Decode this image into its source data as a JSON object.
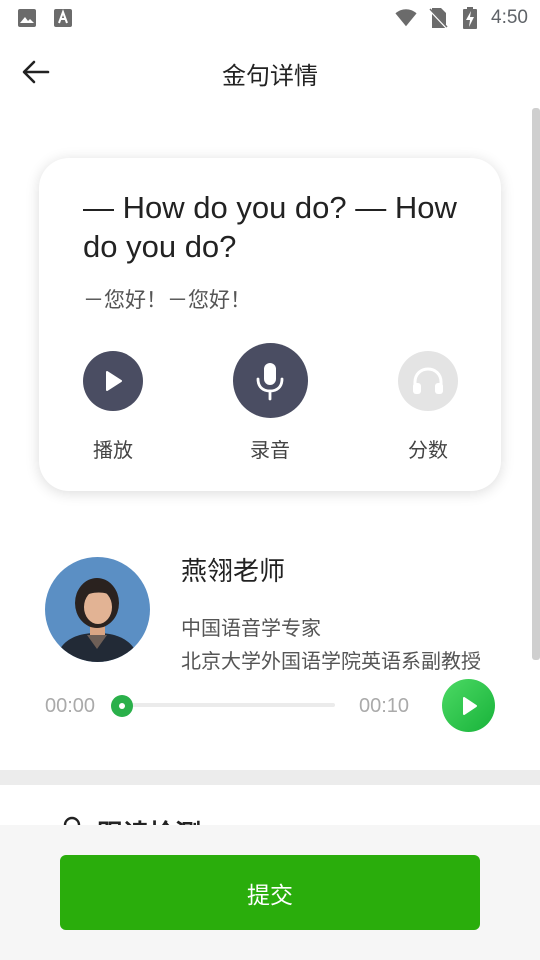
{
  "status_bar": {
    "time": "4:50",
    "left_icons": [
      "image-icon",
      "text-a-icon"
    ],
    "right_icons": [
      "wifi-icon",
      "no-sim-icon",
      "battery-charging-icon"
    ]
  },
  "header": {
    "title": "金句详情",
    "back_icon": "arrow-left-icon"
  },
  "card": {
    "sentence_en": "— How do you do? — How do you do?",
    "sentence_cn": "－您好！－您好！",
    "actions": [
      {
        "label": "播放",
        "icon": "play-icon",
        "color": "#4a4d62"
      },
      {
        "label": "录音",
        "icon": "microphone-icon",
        "color": "#4a4d62"
      },
      {
        "label": "分数",
        "icon": "headphones-icon",
        "color": "#e4e4e4"
      }
    ]
  },
  "teacher": {
    "name": "燕翎老师",
    "title_line1": "中国语音学专家",
    "title_line2": "北京大学外国语学院英语系副教授",
    "avatar_icon": "teacher-avatar"
  },
  "player": {
    "current_time": "00:00",
    "total_time": "00:10",
    "progress": 0,
    "accent_color": "#2ab04a"
  },
  "next_section": {
    "title": "跟读检测",
    "icon": "search-icon"
  },
  "bottom": {
    "submit_label": "提交",
    "submit_color": "#2aad0c"
  }
}
